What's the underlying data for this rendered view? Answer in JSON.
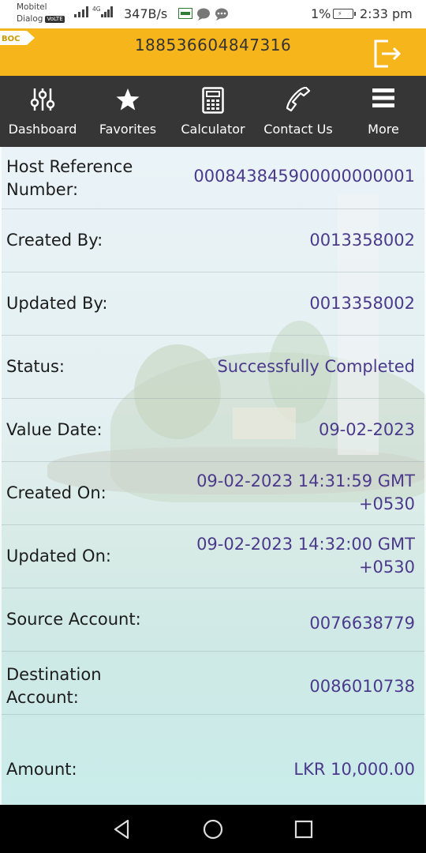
{
  "status_bar": {
    "carrier_line1": "Mobitel",
    "carrier_line2": "Dialog",
    "volte": "VoLTE",
    "network_type": "4G",
    "network_speed": "347B/s",
    "battery_percent": "1%",
    "time": "2:33 pm"
  },
  "header": {
    "logo": "BOC",
    "account_id": "188536604847316"
  },
  "nav": {
    "items": [
      {
        "label": "Dashboard",
        "icon": "sliders-icon"
      },
      {
        "label": "Favorites",
        "icon": "star-icon"
      },
      {
        "label": "Calculator",
        "icon": "calculator-icon"
      },
      {
        "label": "Contact Us",
        "icon": "phone-icon"
      },
      {
        "label": "More",
        "icon": "menu-icon"
      }
    ]
  },
  "details": [
    {
      "label": "Host Reference\nNumber:",
      "value": "000843845900000000001"
    },
    {
      "label": "Created By:",
      "value": "0013358002"
    },
    {
      "label": "Updated By:",
      "value": "0013358002"
    },
    {
      "label": "Status:",
      "value": "Successfully Completed"
    },
    {
      "label": "Value Date:",
      "value": "09-02-2023"
    },
    {
      "label": "Created On:",
      "value": "09-02-2023 14:31:59 GMT\n+0530"
    },
    {
      "label": "Updated On:",
      "value": "09-02-2023 14:32:00 GMT\n+0530"
    },
    {
      "label": "Source Account:",
      "value": "0076638779"
    },
    {
      "label": "Destination\nAccount:",
      "value": "0086010738"
    },
    {
      "label": "Amount:",
      "value": "LKR 10,000.00"
    }
  ],
  "colors": {
    "header_bg": "#f7b51c",
    "nav_bg": "#363636",
    "value_text": "#4b3a8c"
  }
}
